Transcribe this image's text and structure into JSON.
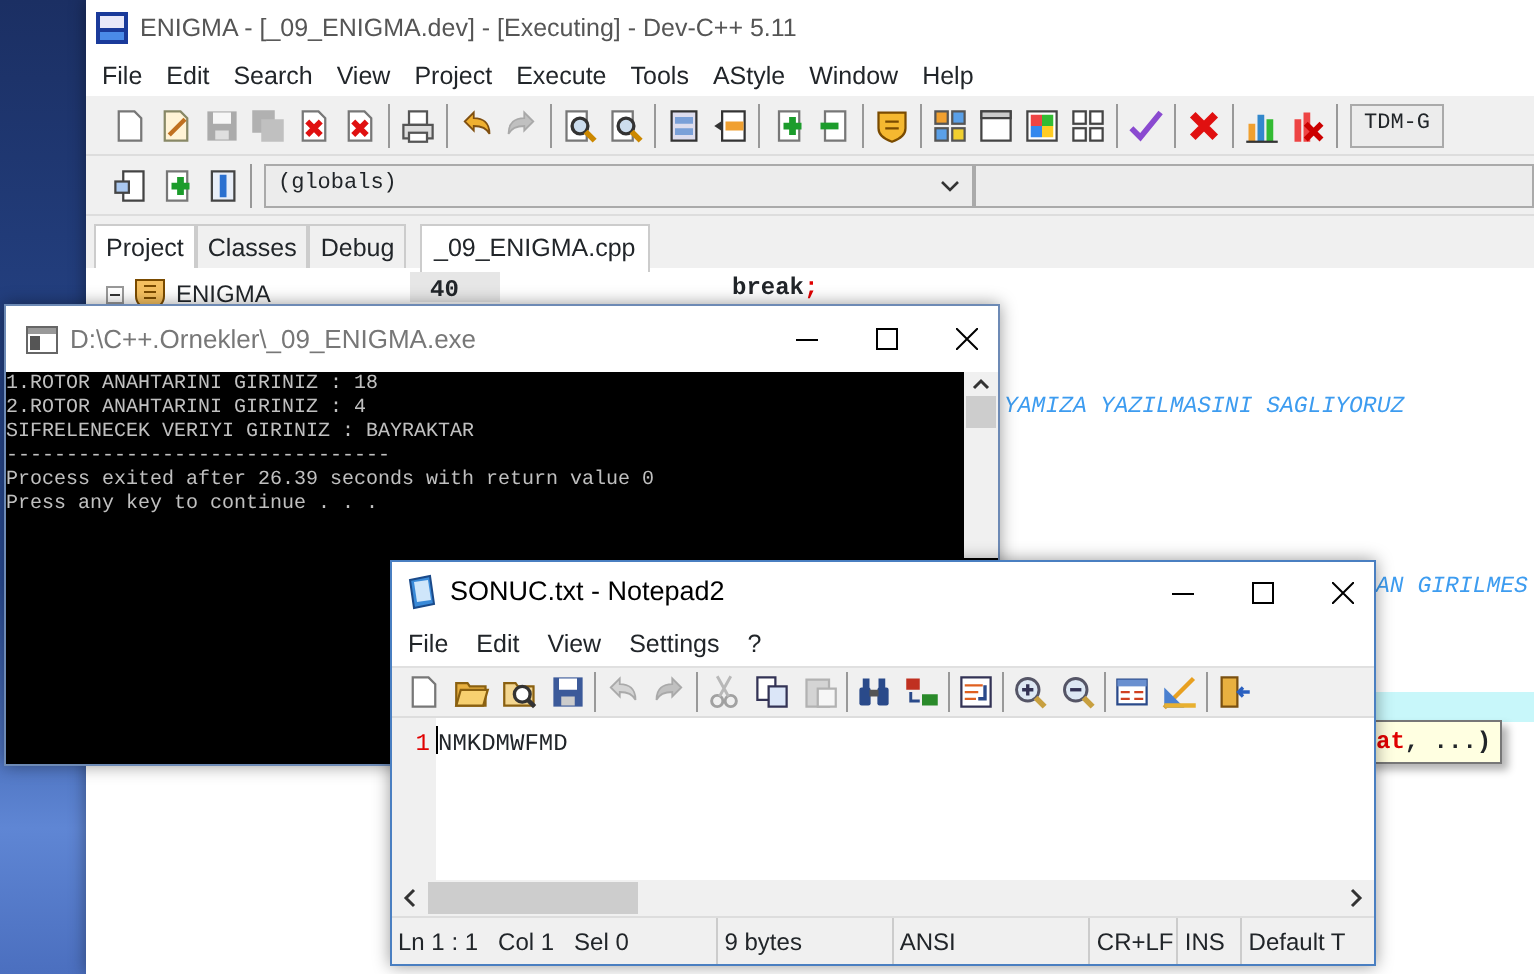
{
  "devcpp": {
    "title": "ENIGMA - [_09_ENIGMA.dev] - [Executing] - Dev-C++ 5.11",
    "menu": [
      "File",
      "Edit",
      "Search",
      "View",
      "Project",
      "Execute",
      "Tools",
      "AStyle",
      "Window",
      "Help"
    ],
    "toolbar": [
      [
        {
          "disabled": false
        },
        {
          "disabled": false
        },
        {
          "disabled": true
        },
        {
          "disabled": true
        },
        {
          "disabled": false
        },
        {
          "disabled": false
        }
      ],
      [
        {
          "disabled": false
        }
      ],
      [
        {
          "disabled": false
        },
        {
          "disabled": true
        }
      ],
      [
        {
          "disabled": false
        },
        {
          "disabled": false
        }
      ],
      [
        {
          "disabled": false
        },
        {
          "disabled": false
        }
      ],
      [
        {
          "disabled": false
        },
        {
          "disabled": false
        }
      ],
      [
        {
          "disabled": false
        }
      ],
      [
        {
          "disabled": false
        },
        {
          "disabled": false
        },
        {
          "disabled": false
        },
        {
          "disabled": false
        }
      ],
      [
        {
          "disabled": false
        }
      ],
      [
        {
          "disabled": false
        }
      ],
      [
        {
          "disabled": false
        },
        {
          "disabled": false
        }
      ]
    ],
    "compiler": "TDM-G",
    "scope": "(globals)",
    "side_tabs": [
      {
        "label": "Project",
        "selected": true
      },
      {
        "label": "Classes",
        "selected": false
      },
      {
        "label": "Debug",
        "selected": false
      }
    ],
    "tree": [
      {
        "label": "ENIGMA",
        "expanded": true
      }
    ],
    "editor_tab": "_09_ENIGMA.cpp",
    "line": {
      "number": "40",
      "keyword": "break",
      "punct": ";"
    },
    "comments": [
      "YAMIZA YAZILMASINI SAGLIYORUZ",
      "AN GIRILMES"
    ],
    "tooltip": {
      "param": "at",
      "rest": ", ...)"
    }
  },
  "console": {
    "title": "D:\\C++.Ornekler\\_09_ENIGMA.exe",
    "lines": [
      "1.ROTOR ANAHTARINI GIRINIZ : 18",
      "2.ROTOR ANAHTARINI GIRINIZ : 4",
      "SIFRELENECEK VERIYI GIRINIZ : BAYRAKTAR",
      "--------------------------------",
      "Process exited after 26.39 seconds with return value 0",
      "Press any key to continue . . ."
    ]
  },
  "notepad": {
    "title": "SONUC.txt - Notepad2",
    "menu": [
      "File",
      "Edit",
      "View",
      "Settings",
      "?"
    ],
    "toolbar": [
      [
        {
          "disabled": false
        },
        {
          "disabled": false
        },
        {
          "disabled": false
        },
        {
          "disabled": false
        }
      ],
      [
        {
          "disabled": true
        },
        {
          "disabled": true
        }
      ],
      [
        {
          "disabled": true
        },
        {
          "disabled": false
        },
        {
          "disabled": true
        }
      ],
      [
        {
          "disabled": false
        },
        {
          "disabled": false
        }
      ],
      [
        {
          "disabled": false
        }
      ],
      [
        {
          "disabled": false
        },
        {
          "disabled": false
        }
      ],
      [
        {
          "disabled": false
        },
        {
          "disabled": false
        }
      ],
      [
        {
          "disabled": false
        }
      ]
    ],
    "line_number": "1",
    "text": "NMKDMWFMD",
    "status": [
      "Ln 1 : 1   Col 1   Sel 0",
      "9 bytes",
      "ANSI",
      "CR+LF",
      "INS",
      "Default T"
    ]
  }
}
